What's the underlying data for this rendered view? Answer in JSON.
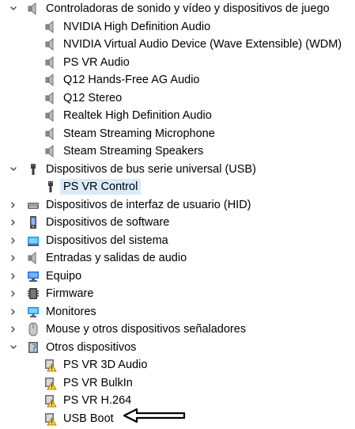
{
  "tree": {
    "items": [
      {
        "label": "Controladoras de sonido y vídeo y dispositivos de juego",
        "level": 0,
        "expanded": true,
        "icon": "speaker-icon"
      },
      {
        "label": "NVIDIA High Definition Audio",
        "level": 1,
        "icon": "speaker-icon"
      },
      {
        "label": "NVIDIA Virtual Audio Device (Wave Extensible) (WDM)",
        "level": 1,
        "icon": "speaker-icon"
      },
      {
        "label": "PS VR Audio",
        "level": 1,
        "icon": "speaker-icon"
      },
      {
        "label": "Q12 Hands-Free AG Audio",
        "level": 1,
        "icon": "speaker-icon"
      },
      {
        "label": "Q12 Stereo",
        "level": 1,
        "icon": "speaker-icon"
      },
      {
        "label": "Realtek High Definition Audio",
        "level": 1,
        "icon": "speaker-icon"
      },
      {
        "label": "Steam Streaming Microphone",
        "level": 1,
        "icon": "speaker-icon"
      },
      {
        "label": "Steam Streaming Speakers",
        "level": 1,
        "icon": "speaker-icon"
      },
      {
        "label": "Dispositivos de bus serie universal (USB)",
        "level": 0,
        "expanded": true,
        "icon": "usb-icon"
      },
      {
        "label": "PS VR Control",
        "level": 1,
        "icon": "usb-icon",
        "selected": true
      },
      {
        "label": "Dispositivos de interfaz de usuario (HID)",
        "level": 0,
        "expanded": false,
        "icon": "keyboard-icon"
      },
      {
        "label": "Dispositivos de software",
        "level": 0,
        "expanded": false,
        "icon": "software-device-icon"
      },
      {
        "label": "Dispositivos del sistema",
        "level": 0,
        "expanded": false,
        "icon": "system-devices-icon"
      },
      {
        "label": "Entradas y salidas de audio",
        "level": 0,
        "expanded": false,
        "icon": "speaker-icon"
      },
      {
        "label": "Equipo",
        "level": 0,
        "expanded": false,
        "icon": "computer-icon"
      },
      {
        "label": "Firmware",
        "level": 0,
        "expanded": false,
        "icon": "firmware-icon"
      },
      {
        "label": "Monitores",
        "level": 0,
        "expanded": false,
        "icon": "monitor-icon"
      },
      {
        "label": "Mouse y otros dispositivos señaladores",
        "level": 0,
        "expanded": false,
        "icon": "mouse-icon"
      },
      {
        "label": "Otros dispositivos",
        "level": 0,
        "expanded": true,
        "icon": "other-devices-icon"
      },
      {
        "label": "PS VR 3D Audio",
        "level": 1,
        "icon": "warning-device-icon"
      },
      {
        "label": "PS VR BulkIn",
        "level": 1,
        "icon": "warning-device-icon"
      },
      {
        "label": "PS VR H.264",
        "level": 1,
        "icon": "warning-device-icon"
      },
      {
        "label": "USB Boot",
        "level": 1,
        "icon": "warning-device-icon"
      }
    ]
  },
  "annotation": {
    "arrow_color": "#000000"
  }
}
